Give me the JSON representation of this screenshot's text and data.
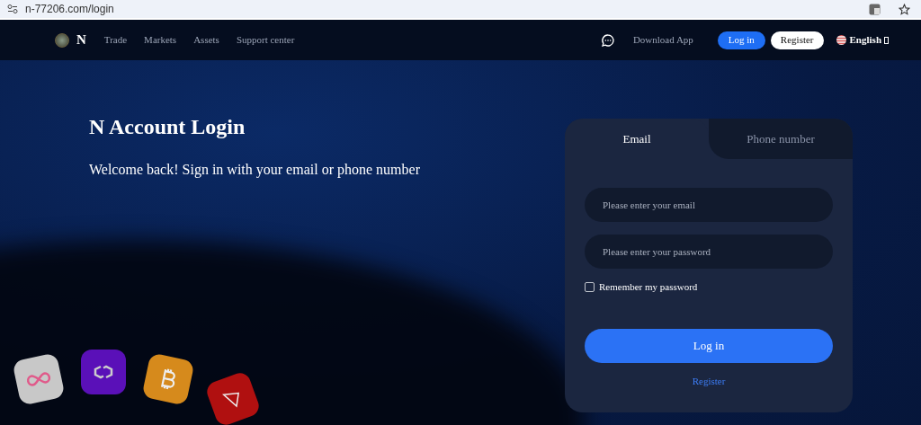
{
  "browser": {
    "url": "n-77206.com/login"
  },
  "nav": {
    "logo": "N",
    "links": [
      "Trade",
      "Markets",
      "Assets",
      "Support center"
    ],
    "download": "Download App",
    "login": "Log in",
    "register": "Register",
    "language": "English"
  },
  "hero": {
    "title": "N Account Login",
    "subtitle": "Welcome back! Sign in with your email or phone number"
  },
  "tabs": [
    {
      "label": "Email",
      "selected": true
    },
    {
      "label": "Phone number",
      "selected": false
    }
  ],
  "fields": [
    {
      "placeholder": "Please enter your email"
    },
    {
      "placeholder": "Please enter your password"
    }
  ],
  "remember": {
    "label": "Remember my password",
    "checked": false
  },
  "submit": "Log in",
  "register_link": "Register"
}
